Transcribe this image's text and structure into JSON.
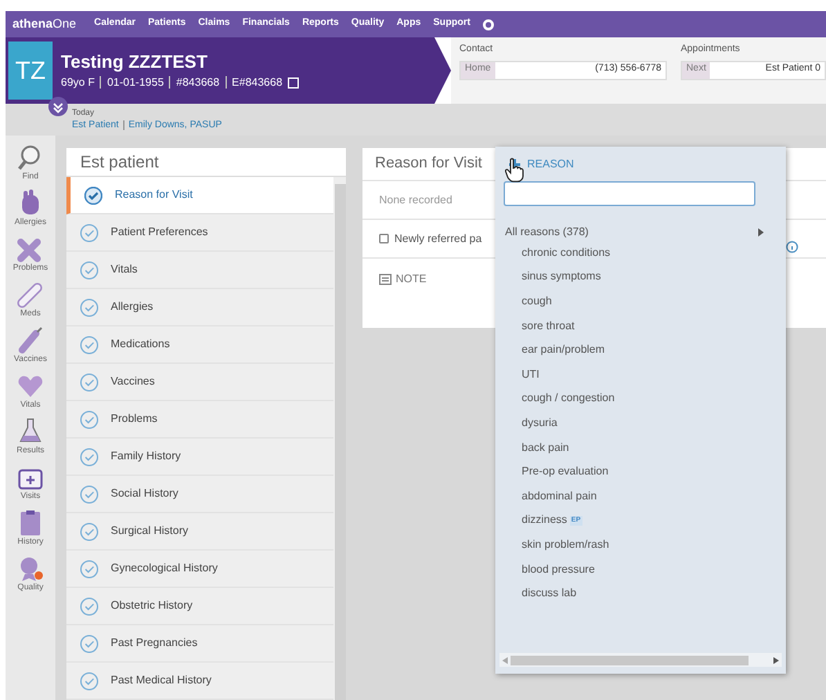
{
  "nav": {
    "logo_bold": "athena",
    "logo_light": "One",
    "items": [
      "Calendar",
      "Patients",
      "Claims",
      "Financials",
      "Reports",
      "Quality",
      "Apps",
      "Support"
    ]
  },
  "patient": {
    "initials": "TZ",
    "name": "Testing ZZZTEST",
    "details": [
      "69yo F",
      "01-01-1955",
      "#843668",
      "E#843668"
    ]
  },
  "contact": {
    "label": "Contact",
    "field_label": "Home",
    "value": "(713) 556-6778"
  },
  "appointments": {
    "label": "Appointments",
    "field_label": "Next",
    "value": "Est Patient 0"
  },
  "today": {
    "label": "Today",
    "visit_type": "Est Patient",
    "provider": "Emily Downs, PASUP"
  },
  "rail": [
    {
      "label": "Find",
      "kind": "find"
    },
    {
      "label": "Allergies",
      "kind": "hand"
    },
    {
      "label": "Problems",
      "kind": "bandage"
    },
    {
      "label": "Meds",
      "kind": "pill"
    },
    {
      "label": "Vaccines",
      "kind": "syringe"
    },
    {
      "label": "Vitals",
      "kind": "heart"
    },
    {
      "label": "Results",
      "kind": "flask"
    },
    {
      "label": "Visits",
      "kind": "kit"
    },
    {
      "label": "History",
      "kind": "clipboard"
    },
    {
      "label": "Quality",
      "kind": "badge"
    }
  ],
  "checklist": {
    "title": "Est patient",
    "items": [
      {
        "label": "Reason for Visit",
        "selected": true
      },
      {
        "label": "Patient Preferences",
        "selected": false
      },
      {
        "label": "Vitals",
        "selected": false
      },
      {
        "label": "Allergies",
        "selected": false
      },
      {
        "label": "Medications",
        "selected": false
      },
      {
        "label": "Vaccines",
        "selected": false
      },
      {
        "label": "Problems",
        "selected": false
      },
      {
        "label": "Family History",
        "selected": false
      },
      {
        "label": "Social History",
        "selected": false
      },
      {
        "label": "Surgical History",
        "selected": false
      },
      {
        "label": "Gynecological History",
        "selected": false
      },
      {
        "label": "Obstetric History",
        "selected": false
      },
      {
        "label": "Past Pregnancies",
        "selected": false
      },
      {
        "label": "Past Medical History",
        "selected": false
      }
    ]
  },
  "section": {
    "title": "Reason for Visit",
    "status": "None recorded",
    "checkbox": {
      "label": "Newly referred pa",
      "checked": false
    },
    "note_button": "NOTE"
  },
  "dropdown": {
    "add_button": "REASON",
    "all_reasons": "All reasons (378)",
    "items": [
      {
        "label": "chronic conditions"
      },
      {
        "label": "sinus symptoms"
      },
      {
        "label": "cough"
      },
      {
        "label": "sore throat"
      },
      {
        "label": "ear pain/problem"
      },
      {
        "label": "UTI"
      },
      {
        "label": "cough / congestion"
      },
      {
        "label": "dysuria"
      },
      {
        "label": "back pain"
      },
      {
        "label": "Pre-op evaluation"
      },
      {
        "label": "abdominal pain"
      },
      {
        "label": "dizziness",
        "badge": "EP"
      },
      {
        "label": "skin problem/rash"
      },
      {
        "label": "blood pressure"
      },
      {
        "label": "discuss lab"
      }
    ]
  }
}
